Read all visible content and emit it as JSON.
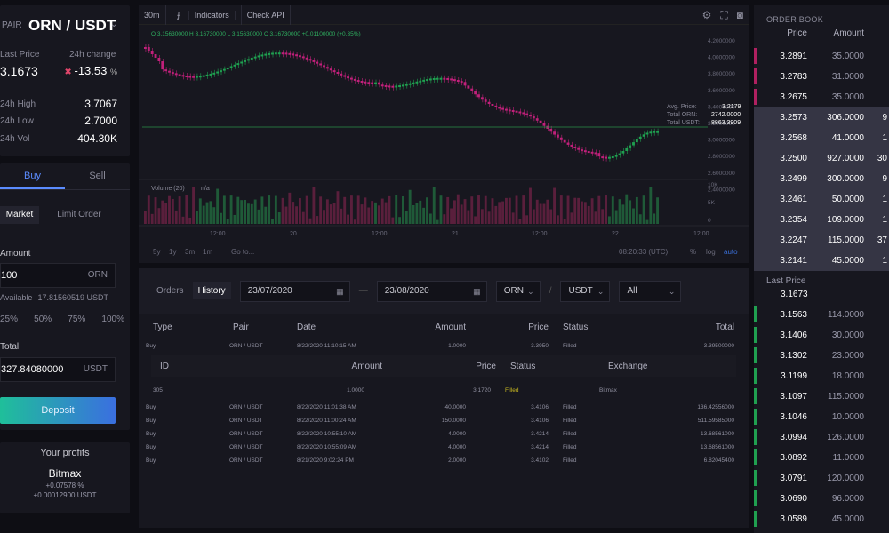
{
  "pair": {
    "label": "PAIR",
    "value": "ORN / USDT"
  },
  "market": {
    "last_price_label": "Last Price",
    "last_price": "3.1673",
    "change_label": "24h change",
    "change": "-13.53",
    "change_unit": "%",
    "high_label": "24h High",
    "high": "3.7067",
    "low_label": "24h Low",
    "low": "2.7000",
    "vol_label": "24h Vol",
    "vol": "404.30K"
  },
  "trade": {
    "tabs": [
      "Buy",
      "Sell"
    ],
    "order_types": [
      "Market",
      "Limit Order"
    ],
    "amount_label": "Amount",
    "amount_value": "100",
    "amount_unit": "ORN",
    "available_label": "Available",
    "available_value": "17.81560519 USDT",
    "percents": [
      "25%",
      "50%",
      "75%",
      "100%"
    ],
    "total_label": "Total",
    "total_value": "327.84080000",
    "total_unit": "USDT",
    "deposit_label": "Deposit"
  },
  "profits": {
    "title": "Your profits",
    "exchange": "Bitmax",
    "pct": "+0.07578 %",
    "usdt": "+0.00012900 USDT"
  },
  "chart": {
    "interval": "30m",
    "indicators_label": "Indicators",
    "check_api_label": "Check API",
    "ohlc_line": "O 3.15630000  H 3.16730000  L 3.15630000  C 3.16730000  +0.01100000 (+0.35%)",
    "volume_label": "Volume (20)",
    "volume_value": "n/a",
    "avg_price_label": "Avg. Price:",
    "avg_price": "3.2179",
    "total_orn_label": "Total ORN:",
    "total_orn": "2742.0000",
    "total_usdt_label": "Total USDT:",
    "total_usdt": "8863.3909",
    "y_ticks": [
      "4.2000000",
      "4.0000000",
      "3.8000000",
      "3.6000000",
      "3.4000000",
      "3.2000000",
      "3.0000000",
      "2.8000000",
      "2.6000000",
      "2.4000000"
    ],
    "vol_ticks": [
      "10K",
      "5K",
      "0"
    ],
    "x_ticks": [
      "12:00",
      "20",
      "12:00",
      "21",
      "12:00",
      "22",
      "12:00"
    ],
    "ranges": [
      "5y",
      "1y",
      "3m",
      "1m"
    ],
    "goto_label": "Go to...",
    "time": "08:20:33 (UTC)",
    "pct_label": "%",
    "log_label": "log",
    "auto_label": "auto",
    "colors": {
      "up": "#1fa050",
      "down": "#c0207a",
      "line": "#2a8f4a"
    }
  },
  "history": {
    "tabs": [
      "Orders",
      "History"
    ],
    "date_from": "23/07/2020",
    "date_to": "23/08/2020",
    "base": "ORN",
    "quote": "USDT",
    "filter": "All",
    "columns": [
      "Type",
      "Pair",
      "Date",
      "Amount",
      "Price",
      "Status",
      "Total"
    ],
    "sub_columns": [
      "ID",
      "Amount",
      "Price",
      "Status",
      "Exchange"
    ],
    "first_row": [
      "Buy",
      "ORN / USDT",
      "8/22/2020 11:10:15 AM",
      "1.0000",
      "3.3950",
      "Filled",
      "3.39500000"
    ],
    "sub_row": [
      "305",
      "1.0000",
      "3.1720",
      "Filled",
      "Bitmax"
    ],
    "rows": [
      [
        "Buy",
        "ORN / USDT",
        "8/22/2020 11:01:38 AM",
        "40.0000",
        "3.4106",
        "Filled",
        "136.42556000"
      ],
      [
        "Buy",
        "ORN / USDT",
        "8/22/2020 11:00:24 AM",
        "150.0000",
        "3.4106",
        "Filled",
        "511.59585000"
      ],
      [
        "Buy",
        "ORN / USDT",
        "8/22/2020 10:55:10 AM",
        "4.0000",
        "3.4214",
        "Filled",
        "13.68561000"
      ],
      [
        "Buy",
        "ORN / USDT",
        "8/22/2020 10:55:09 AM",
        "4.0000",
        "3.4214",
        "Filled",
        "13.68561000"
      ],
      [
        "Buy",
        "ORN / USDT",
        "8/21/2020 9:02:24 PM",
        "2.0000",
        "3.4102",
        "Filled",
        "6.82045400"
      ]
    ]
  },
  "orderbook": {
    "title": "ORDER BOOK",
    "columns": [
      "Price",
      "Amount"
    ],
    "asks": [
      [
        "3.2891",
        "35.0000",
        ""
      ],
      [
        "3.2783",
        "31.0000",
        ""
      ],
      [
        "3.2675",
        "35.0000",
        ""
      ]
    ],
    "asks_hl": [
      [
        "3.2573",
        "306.0000",
        "9"
      ],
      [
        "3.2568",
        "41.0000",
        "1"
      ],
      [
        "3.2500",
        "927.0000",
        "30"
      ],
      [
        "3.2499",
        "300.0000",
        "9"
      ],
      [
        "3.2461",
        "50.0000",
        "1"
      ],
      [
        "3.2354",
        "109.0000",
        "1"
      ],
      [
        "3.2247",
        "115.0000",
        "37"
      ],
      [
        "3.2141",
        "45.0000",
        "1"
      ]
    ],
    "last_price_label": "Last Price",
    "last_price": "3.1673",
    "bids": [
      [
        "3.1563",
        "114.0000",
        ""
      ],
      [
        "3.1406",
        "30.0000",
        ""
      ],
      [
        "3.1302",
        "23.0000",
        ""
      ],
      [
        "3.1199",
        "18.0000",
        ""
      ],
      [
        "3.1097",
        "115.0000",
        ""
      ],
      [
        "3.1046",
        "10.0000",
        ""
      ],
      [
        "3.0994",
        "126.0000",
        ""
      ],
      [
        "3.0892",
        "11.0000",
        ""
      ],
      [
        "3.0791",
        "120.0000",
        ""
      ],
      [
        "3.0690",
        "96.0000",
        ""
      ],
      [
        "3.0589",
        "45.0000",
        ""
      ]
    ]
  }
}
